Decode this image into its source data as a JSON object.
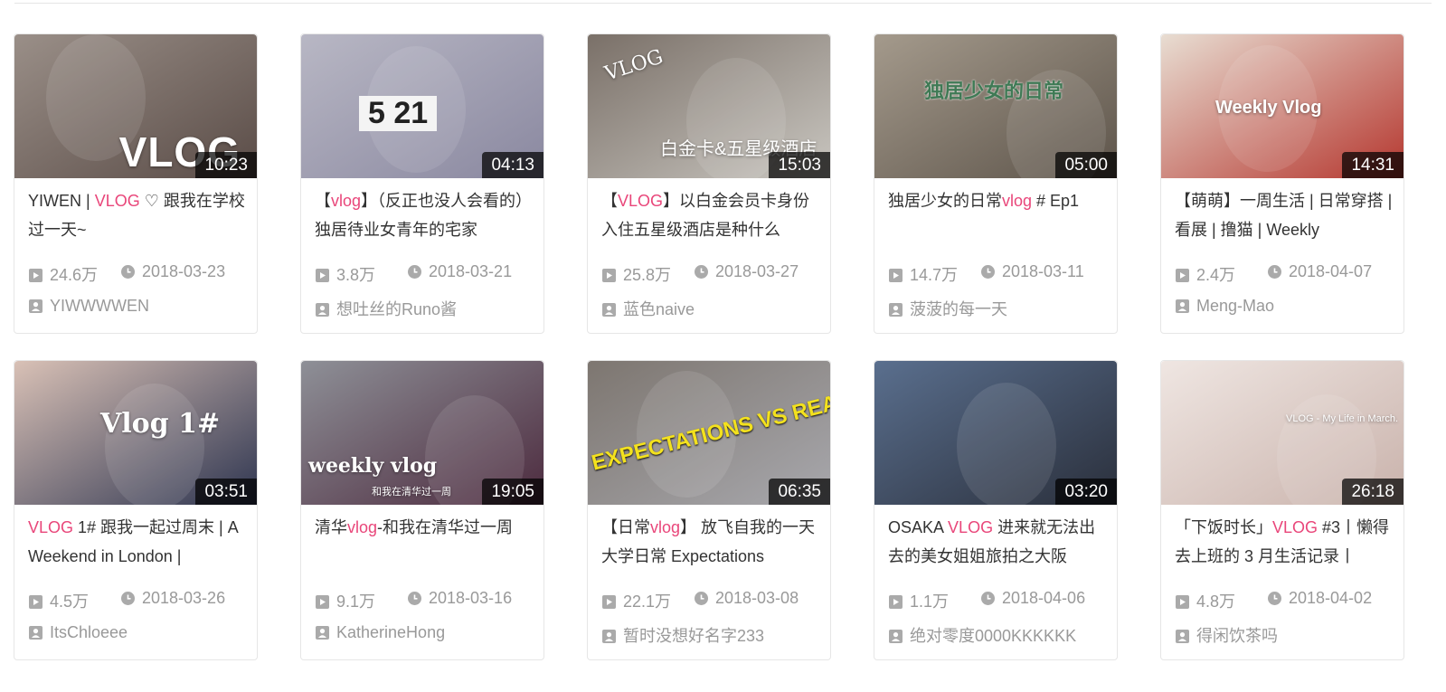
{
  "cards": [
    {
      "title_parts": [
        "YIWEN | ",
        "VLOG",
        " ♡ 跟我在学校过一天~"
      ],
      "duration": "10:23",
      "views": "24.6万",
      "date": "2018-03-23",
      "author": "YIWWWWEN",
      "overlay": "VLOG",
      "thumb_colors": [
        "#9a8f88",
        "#5a4c47"
      ]
    },
    {
      "title_parts": [
        "【",
        "vlog",
        "】（反正也没人会看的）独居待业女青年的宅家"
      ],
      "duration": "04:13",
      "views": "3.8万",
      "date": "2018-03-21",
      "author": "想吐丝的Runo酱",
      "overlay": "5 21",
      "thumb_colors": [
        "#b8b7c4",
        "#8a88a0"
      ]
    },
    {
      "title_parts": [
        "【",
        "VLOG",
        "】以白金会员卡身份入住五星级酒店是种什么"
      ],
      "duration": "15:03",
      "views": "25.8万",
      "date": "2018-03-27",
      "author": "蓝色naive",
      "overlay": "白金卡&五星级酒店",
      "overlay2": "VLOG",
      "thumb_colors": [
        "#7a7068",
        "#c9c6c0"
      ]
    },
    {
      "title_parts": [
        "独居少女的日常",
        "vlog",
        " # Ep1"
      ],
      "duration": "05:00",
      "views": "14.7万",
      "date": "2018-03-11",
      "author": "菠菠的每一天",
      "overlay": "独居少女的日常",
      "thumb_colors": [
        "#a49a8c",
        "#5d544a"
      ]
    },
    {
      "title_parts": [
        "【萌萌】一周生活 | 日常穿搭 | 看展 | 撸猫 | Weekly"
      ],
      "duration": "14:31",
      "views": "2.4万",
      "date": "2018-04-07",
      "author": "Meng-Mao",
      "overlay": "Weekly Vlog",
      "thumb_colors": [
        "#e8ddd2",
        "#b5372f"
      ]
    },
    {
      "title_parts": [
        "",
        "VLOG",
        " 1# 跟我一起过周末 | A Weekend in London |"
      ],
      "duration": "03:51",
      "views": "4.5万",
      "date": "2018-03-26",
      "author": "ItsChloeee",
      "overlay": "Vlog 1#",
      "thumb_colors": [
        "#d9c1b6",
        "#2e3550"
      ]
    },
    {
      "title_parts": [
        "清华",
        "vlog",
        "-和我在清华过一周"
      ],
      "duration": "19:05",
      "views": "9.1万",
      "date": "2018-03-16",
      "author": "KatherineHong",
      "overlay": "weekly vlog",
      "overlay2": "和我在清华过一周",
      "thumb_colors": [
        "#8e9097",
        "#4c2a3e"
      ]
    },
    {
      "title_parts": [
        "【日常",
        "vlog",
        "】 放飞自我的一天大学日常 Expectations"
      ],
      "duration": "06:35",
      "views": "22.1万",
      "date": "2018-03-08",
      "author": "暂时没想好名字233",
      "overlay": "EXPECTATIONS VS REALITY",
      "thumb_colors": [
        "#7d7670",
        "#a8a8ad"
      ]
    },
    {
      "title_parts": [
        "OSAKA ",
        "VLOG",
        " 进来就无法出去的美女姐姐旅拍之大阪"
      ],
      "duration": "03:20",
      "views": "1.1万",
      "date": "2018-04-06",
      "author": "绝对零度0000KKKKKK",
      "overlay": "",
      "thumb_colors": [
        "#5a6f8e",
        "#2a2f3b"
      ]
    },
    {
      "title_parts": [
        "「下饭时长」",
        "VLOG",
        " #3丨懒得去上班的 3 月生活记录丨"
      ],
      "duration": "26:18",
      "views": "4.8万",
      "date": "2018-04-02",
      "author": "得闲饮茶吗",
      "overlay": "VLOG - My Life in March.",
      "thumb_colors": [
        "#efe6e2",
        "#c9b2ab"
      ]
    }
  ],
  "colors": {
    "accent": "#e9467a",
    "meta": "#999999",
    "icon": "#aaaaaa"
  },
  "icons": {
    "views": "play-icon",
    "date": "clock-icon",
    "author": "user-icon"
  }
}
